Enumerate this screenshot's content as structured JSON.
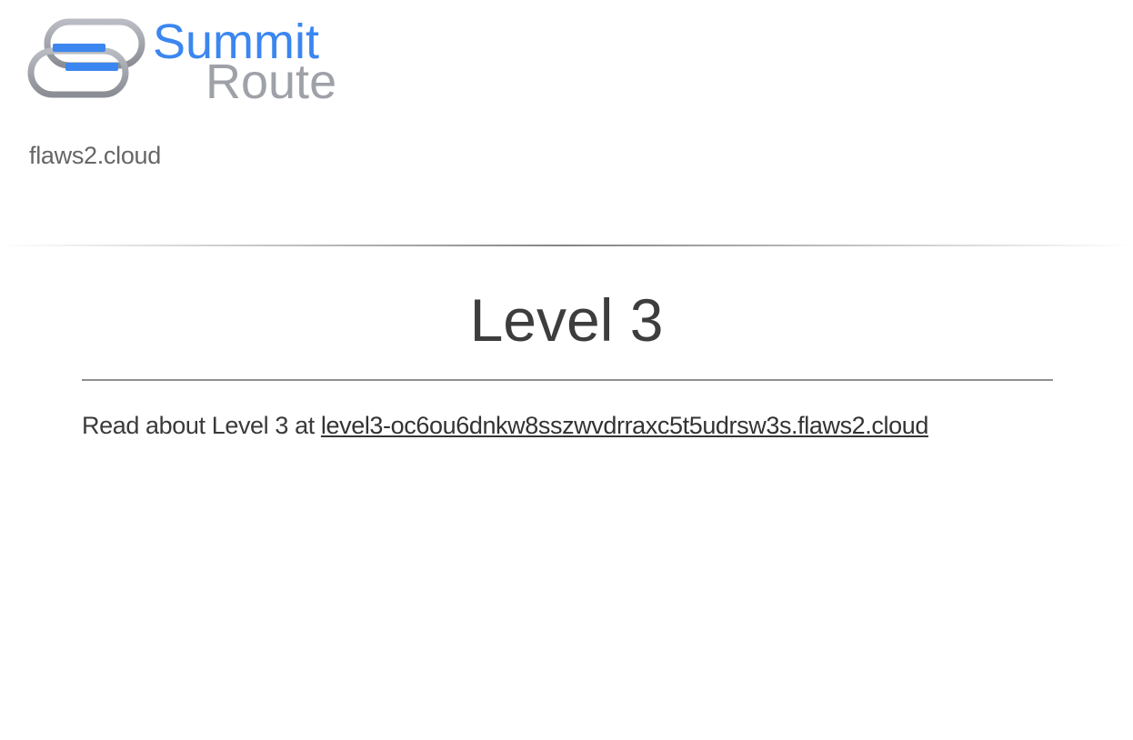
{
  "brand": {
    "logo_line1": "Summit",
    "logo_line2": "Route",
    "colors": {
      "blue": "#3b86f0",
      "gray": "#9ea1a8"
    }
  },
  "site": {
    "name": "flaws2.cloud"
  },
  "main": {
    "title": "Level 3",
    "read_prefix": "Read about Level 3 at ",
    "link_text": "level3-oc6ou6dnkw8sszwvdrraxc5t5udrsw3s.flaws2.cloud"
  }
}
